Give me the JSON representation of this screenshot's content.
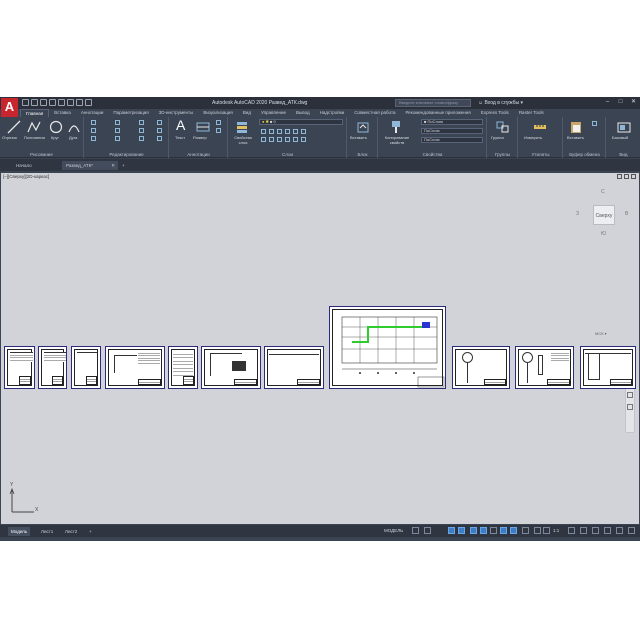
{
  "app": {
    "logo": "A",
    "title": "Autodesk AutoCAD 2020   Развед_АТК.dwg",
    "search_placeholder": "Введите ключевое слово/фразу",
    "user": "Вход в службы",
    "minimize": "–",
    "maximize": "□",
    "close": "✕"
  },
  "ribbon_tabs": [
    "Главная",
    "Вставка",
    "Аннотации",
    "Параметризация",
    "3D-инструменты",
    "Визуализация",
    "Вид",
    "Управление",
    "Вывод",
    "Надстройки",
    "Совместная работа",
    "Рекомендованные приложения",
    "Express Tools",
    "Raster Tools"
  ],
  "ribbon": {
    "draw": {
      "title": "Рисование",
      "line": "Отрезок",
      "polyline": "Полилиния",
      "circle": "Круг",
      "arc": "Дуга"
    },
    "modify": {
      "title": "Редактирование"
    },
    "annotation": {
      "title": "Аннотации",
      "text": "Текст",
      "dimension": "Размер"
    },
    "layers": {
      "title": "Слои",
      "layer_props": "Свойства слоя"
    },
    "block": {
      "title": "Блок",
      "insert": "Вставить"
    },
    "properties": {
      "title": "Свойства",
      "match": "Копирование свойств",
      "bylayer1": "ПоСлою",
      "bylayer2": "ПоСлою",
      "bylayer3": "ПоСлою"
    },
    "groups": {
      "title": "Группы",
      "group": "Группа"
    },
    "utilities": {
      "title": "Утилиты",
      "measure": "Измерить"
    },
    "clipboard": {
      "title": "Буфер обмена",
      "paste": "Вставить"
    },
    "view": {
      "title": "Вид",
      "base": "Базовый"
    }
  },
  "doc_tabs": {
    "start": "Начало",
    "file": "Развед_АТК*",
    "close": "✕",
    "add": "+"
  },
  "viewport": {
    "label": "[–][Сверху][2D-каркас]",
    "cube_face": "Сверху",
    "cube_n": "С",
    "cube_s": "Ю",
    "cube_w": "З",
    "cube_e": "В",
    "wcs": "МСК ▾"
  },
  "ucs": {
    "y": "Y",
    "x": "X"
  },
  "layout_tabs": {
    "model": "Модель",
    "sheet1": "Лист1",
    "sheet2": "Лист2",
    "add": "+"
  },
  "status": {
    "model": "МОДЕЛЬ",
    "scale": "1:1"
  },
  "colors": {
    "app_bg": "#3b4453",
    "canvas": "#d1d3d8",
    "accent": "#3c7dc4",
    "logo": "#c8262e",
    "green_route": "#2ecc2e",
    "blue_marker": "#2a35d0"
  }
}
